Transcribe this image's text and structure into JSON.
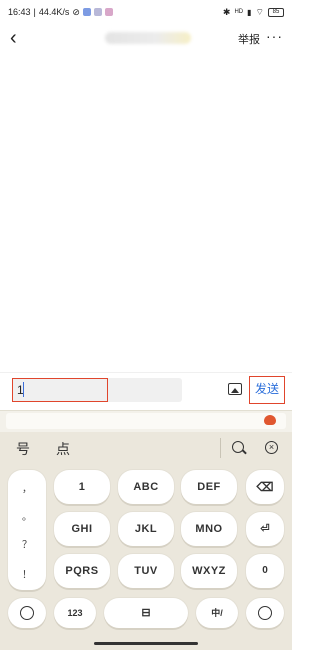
{
  "status_bar": {
    "time": "16:43",
    "speed": "44.4K/s",
    "net_label": "HD",
    "battery": "85"
  },
  "nav": {
    "back_icon": "chevron-left-icon",
    "report_label": "举报",
    "more_label": "···"
  },
  "input": {
    "value": "1",
    "image_icon": "image-icon",
    "send_label": "发送"
  },
  "keyboard": {
    "candidates": [
      "号",
      "点"
    ],
    "punctuation": [
      "，",
      "。",
      "？",
      "！"
    ],
    "rows": [
      [
        "1",
        "ABC",
        "DEF"
      ],
      [
        "GHI",
        "JKL",
        "MNO"
      ],
      [
        "PQRS",
        "TUV",
        "WXYZ"
      ]
    ],
    "right_keys": [
      "⌫",
      "⏎",
      "0"
    ],
    "bottom": {
      "num_label": "123",
      "lang_label": "中/",
      "space_icon": "space-icon"
    },
    "accent": "#e0452c",
    "link_color": "#2c6fdb"
  }
}
